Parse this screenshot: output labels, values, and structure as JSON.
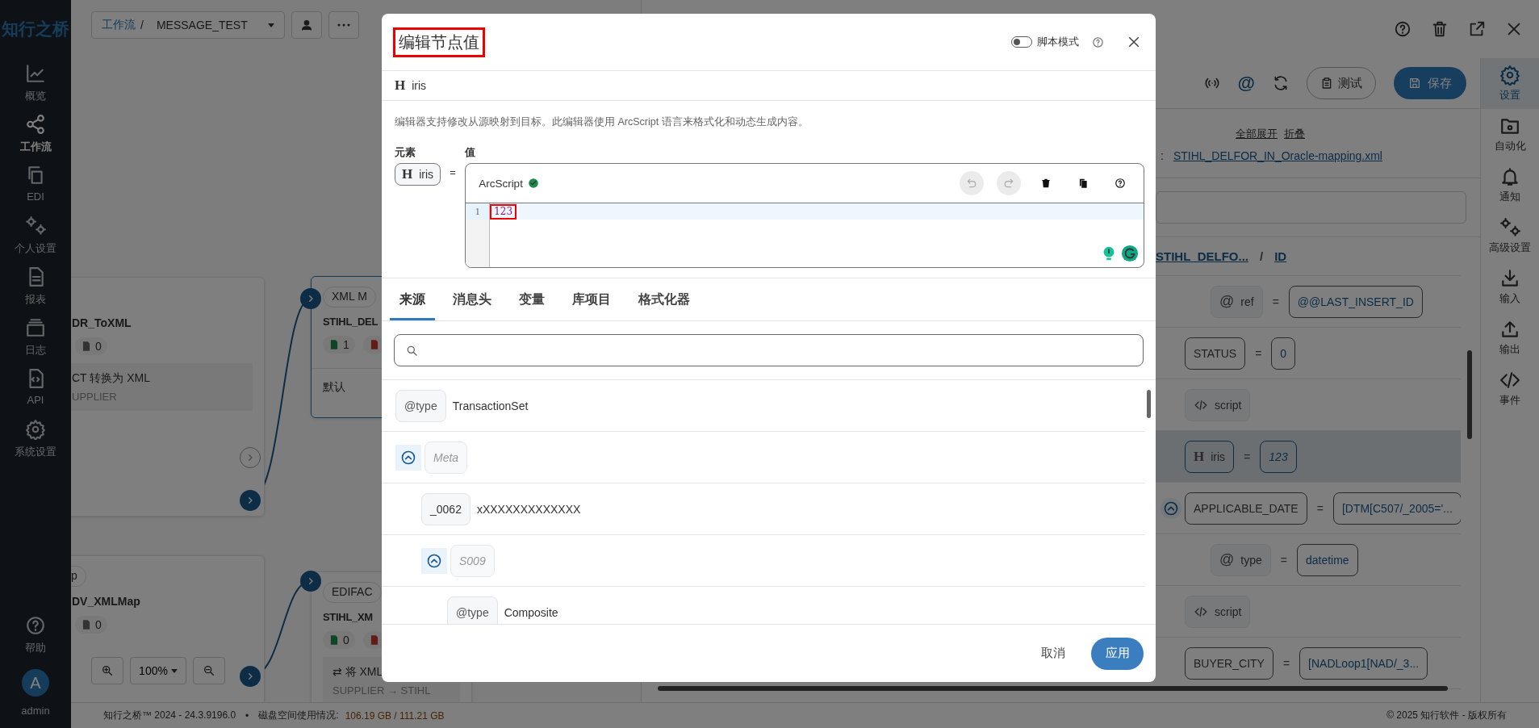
{
  "sidebar": {
    "logo": "知行之桥",
    "items": [
      {
        "label": "概览",
        "selected": false
      },
      {
        "label": "工作流",
        "selected": true
      },
      {
        "label": "EDI",
        "selected": false
      },
      {
        "label": "个人设置",
        "selected": false
      },
      {
        "label": "报表",
        "selected": false
      },
      {
        "label": "日志",
        "selected": false
      },
      {
        "label": "API",
        "selected": false
      },
      {
        "label": "系统设置",
        "selected": false
      }
    ],
    "help": "帮助",
    "user": {
      "initial": "A",
      "name": "admin"
    }
  },
  "workflow_bar": {
    "link": "工作流",
    "separator": "/",
    "name": "MESSAGE_TEST"
  },
  "nodes": [
    {
      "title": "DR_ToXML",
      "selected": false,
      "badges": [
        {
          "kind": "file",
          "count": "0"
        }
      ],
      "desc": [
        "CT 转换为 XML",
        "UPPLIER"
      ]
    },
    {
      "tag": "XML M",
      "title": "STIHL_DEL",
      "selected": true,
      "badges": [
        {
          "kind": "ok",
          "count": "1"
        },
        {
          "kind": "error"
        }
      ],
      "footer": "默认"
    },
    {
      "tag": "p",
      "title": "DV_XMLMap",
      "selected": false,
      "badges": [
        {
          "kind": "file",
          "count": "0"
        }
      ]
    },
    {
      "tag": "EDIFAC",
      "title": "STIHL_XM",
      "selected": false,
      "badges": [
        {
          "kind": "ok",
          "count": "0"
        },
        {
          "kind": "error"
        }
      ],
      "desc": [
        "⇄ 将 XML",
        "SUPPLIER → STIHL"
      ]
    }
  ],
  "zoom": "100%",
  "panel": {
    "test_button": "测试",
    "save_button": "保存",
    "expand_all": "全部展开",
    "collapse": "折叠",
    "file_sep": ":",
    "file": "STIHL_DELFOR_IN_Oracle-mapping.xml",
    "breadcrumb": [
      "STIHL_DELFO...",
      "ID"
    ],
    "breadcrumb_sep": "/",
    "rows": [
      {
        "kind": "attribute",
        "icon": "@",
        "name": "ref",
        "value": "@@LAST_INSERT_ID",
        "selected": false
      },
      {
        "kind": "element",
        "name": "STATUS",
        "value": "0",
        "selected": false
      },
      {
        "kind": "script",
        "name": "script",
        "selected": false
      },
      {
        "kind": "text",
        "icon": "H",
        "name": "iris",
        "value": "123",
        "selected": true
      },
      {
        "kind": "element",
        "name": "APPLICABLE_DATE",
        "value": "[DTM[C507/_2005='...",
        "selected": false,
        "expanded": true,
        "children": [
          {
            "kind": "attribute",
            "icon": "@",
            "name": "type",
            "value": "datetime",
            "selected": false
          }
        ]
      },
      {
        "kind": "script",
        "name": "script",
        "selected": false
      },
      {
        "kind": "element",
        "name": "BUYER_CITY",
        "value": "[NADLoop1[NAD/_3...",
        "selected": false
      }
    ],
    "equals": "="
  },
  "right_bar": [
    {
      "label": "设置",
      "selected": true
    },
    {
      "label": "自动化",
      "selected": false
    },
    {
      "label": "通知",
      "selected": false
    },
    {
      "label": "高级设置",
      "selected": false
    },
    {
      "label": "输入",
      "selected": false
    },
    {
      "label": "输出",
      "selected": false
    },
    {
      "label": "事件",
      "selected": false
    }
  ],
  "footer": {
    "version": "知行之桥™ 2024 - 24.3.9196.0",
    "bullet": "•",
    "disk_label": "磁盘空间使用情况:",
    "disk_value": "106.19 GB / 111.21 GB",
    "copyright": "© 2025 知行软件 - 版权所有"
  },
  "modal": {
    "title": "编辑节点值",
    "title_marked": true,
    "script_mode": {
      "label": "脚本模式",
      "on": false
    },
    "node": {
      "icon": "H",
      "name": "iris"
    },
    "description": "编辑器支持修改从源映射到目标。此编辑器使用 ArcScript 语言来格式化和动态生成内容。",
    "element_label": "元素",
    "value_label": "值",
    "element": {
      "icon": "H",
      "name": "iris"
    },
    "equals": "=",
    "editor": {
      "language": "ArcScript",
      "valid": true,
      "undo_disabled": true,
      "redo_disabled": true,
      "lines": [
        {
          "number": "1",
          "text": "123",
          "marked": true,
          "active": true
        }
      ]
    },
    "tabs": [
      {
        "label": "来源",
        "selected": true
      },
      {
        "label": "消息头",
        "selected": false
      },
      {
        "label": "变量",
        "selected": false
      },
      {
        "label": "库项目",
        "selected": false
      },
      {
        "label": "格式化器",
        "selected": false
      }
    ],
    "tree": [
      {
        "kind": "attribute",
        "name": "@type",
        "value": "TransactionSet"
      },
      {
        "kind": "group",
        "name": "Meta",
        "expanded": true,
        "children": [
          {
            "kind": "element",
            "name": "_0062",
            "value": "xXXXXXXXXXXXXX"
          },
          {
            "kind": "group",
            "name": "S009",
            "expanded": true,
            "children": [
              {
                "kind": "attribute",
                "name": "@type",
                "value": "Composite"
              }
            ]
          }
        ]
      }
    ],
    "cancel": "取消",
    "apply": "应用"
  }
}
